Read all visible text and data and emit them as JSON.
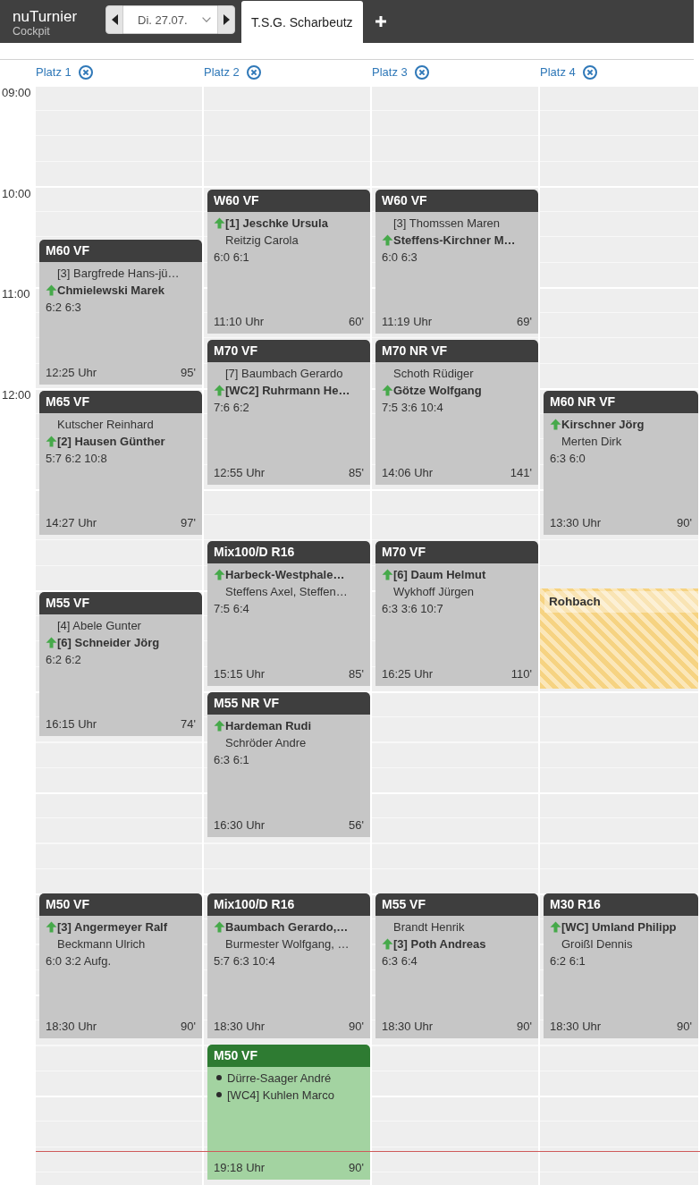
{
  "app": {
    "name": "nuTurnier",
    "subtitle": "Cockpit"
  },
  "date_picker": {
    "value": "Di. 27.07."
  },
  "tabs": [
    {
      "label": "T.S.G. Scharbeutz",
      "selected": true
    }
  ],
  "time_labels": [
    "09:00",
    "10:00",
    "11:00",
    "12:00"
  ],
  "courts": [
    {
      "name": "Platz 1",
      "entries": [
        {
          "kind": "match",
          "title": "M60 VF",
          "players": [
            {
              "name": "[3] Bargfrede Hans-jü…",
              "winner": false
            },
            {
              "name": "Chmielewski Marek",
              "winner": true
            }
          ],
          "score": "6:2 6:3",
          "time": "12:25 Uhr",
          "duration": "95'"
        },
        {
          "kind": "match",
          "title": "M65 VF",
          "players": [
            {
              "name": "Kutscher Reinhard",
              "winner": false
            },
            {
              "name": "[2] Hausen Günther",
              "winner": true
            }
          ],
          "score": "5:7 6:2 10:8",
          "time": "14:27 Uhr",
          "duration": "97'"
        },
        {
          "kind": "match",
          "title": "M55 VF",
          "players": [
            {
              "name": "[4] Abele Gunter",
              "winner": false
            },
            {
              "name": "[6] Schneider Jörg",
              "winner": true
            }
          ],
          "score": "6:2 6:2",
          "time": "16:15 Uhr",
          "duration": "74'"
        },
        {
          "kind": "match",
          "title": "M50 VF",
          "players": [
            {
              "name": "[3] Angermeyer Ralf",
              "winner": true
            },
            {
              "name": "Beckmann Ulrich",
              "winner": false
            }
          ],
          "score": "6:0 3:2 Aufg.",
          "time": "18:30 Uhr",
          "duration": "90'"
        }
      ]
    },
    {
      "name": "Platz 2",
      "entries": [
        {
          "kind": "match",
          "title": "W60 VF",
          "players": [
            {
              "name": "[1] Jeschke Ursula",
              "winner": true
            },
            {
              "name": "Reitzig Carola",
              "winner": false
            }
          ],
          "score": "6:0 6:1",
          "time": "11:10 Uhr",
          "duration": "60'"
        },
        {
          "kind": "match",
          "title": "M70 VF",
          "players": [
            {
              "name": "[7] Baumbach Gerardo",
              "winner": false
            },
            {
              "name": "[WC2] Ruhrmann He…",
              "winner": true
            }
          ],
          "score": "7:6 6:2",
          "time": "12:55 Uhr",
          "duration": "85'"
        },
        {
          "kind": "match",
          "title": "Mix100/D R16",
          "players": [
            {
              "name": "Harbeck-Westphale…",
              "winner": true
            },
            {
              "name": "Steffens Axel, Steffen…",
              "winner": false
            }
          ],
          "score": "7:5 6:4",
          "time": "15:15 Uhr",
          "duration": "85'"
        },
        {
          "kind": "match",
          "title": "M55 NR VF",
          "players": [
            {
              "name": "Hardeman Rudi",
              "winner": true
            },
            {
              "name": "Schröder Andre",
              "winner": false
            }
          ],
          "score": "6:3 6:1",
          "time": "16:30 Uhr",
          "duration": "56'"
        },
        {
          "kind": "match",
          "title": "Mix100/D R16",
          "players": [
            {
              "name": "Baumbach Gerardo,…",
              "winner": true
            },
            {
              "name": "Burmester Wolfgang, …",
              "winner": false
            }
          ],
          "score": "5:7 6:3 10:4",
          "time": "18:30 Uhr",
          "duration": "90'"
        },
        {
          "kind": "scheduled",
          "title": "M50 VF",
          "players": [
            {
              "name": "Dürre-Saager André"
            },
            {
              "name": "[WC4] Kuhlen Marco"
            }
          ],
          "time": "19:18 Uhr",
          "duration": "90'"
        }
      ]
    },
    {
      "name": "Platz 3",
      "entries": [
        {
          "kind": "match",
          "title": "W60 VF",
          "players": [
            {
              "name": "[3] Thomssen Maren",
              "winner": false
            },
            {
              "name": "Steffens-Kirchner M…",
              "winner": true
            }
          ],
          "score": "6:0 6:3",
          "time": "11:19 Uhr",
          "duration": "69'"
        },
        {
          "kind": "match",
          "title": "M70 NR VF",
          "players": [
            {
              "name": "Schoth Rüdiger",
              "winner": false
            },
            {
              "name": "Götze Wolfgang",
              "winner": true
            }
          ],
          "score": "7:5 3:6 10:4",
          "time": "14:06 Uhr",
          "duration": "141'"
        },
        {
          "kind": "match",
          "title": "M70 VF",
          "players": [
            {
              "name": "[6] Daum Helmut",
              "winner": true
            },
            {
              "name": "Wykhoff Jürgen",
              "winner": false
            }
          ],
          "score": "6:3 3:6 10:7",
          "time": "16:25 Uhr",
          "duration": "110'"
        },
        {
          "kind": "match",
          "title": "M55 VF",
          "players": [
            {
              "name": "Brandt Henrik",
              "winner": false
            },
            {
              "name": "[3] Poth Andreas",
              "winner": true
            }
          ],
          "score": "6:3 6:4",
          "time": "18:30 Uhr",
          "duration": "90'"
        }
      ]
    },
    {
      "name": "Platz 4",
      "entries": [
        {
          "kind": "match",
          "title": "M60 NR VF",
          "players": [
            {
              "name": "Kirschner Jörg",
              "winner": true
            },
            {
              "name": "Merten Dirk",
              "winner": false
            }
          ],
          "score": "6:3 6:0",
          "time": "13:30 Uhr",
          "duration": "90'"
        },
        {
          "kind": "blocked",
          "title": "Rohbach"
        },
        {
          "kind": "match",
          "title": "M30 R16",
          "players": [
            {
              "name": "[WC] Umland Philipp",
              "winner": true
            },
            {
              "name": "Groißl Dennis",
              "winner": false
            }
          ],
          "score": "6:2 6:1",
          "time": "18:30 Uhr",
          "duration": "90'"
        }
      ]
    }
  ]
}
